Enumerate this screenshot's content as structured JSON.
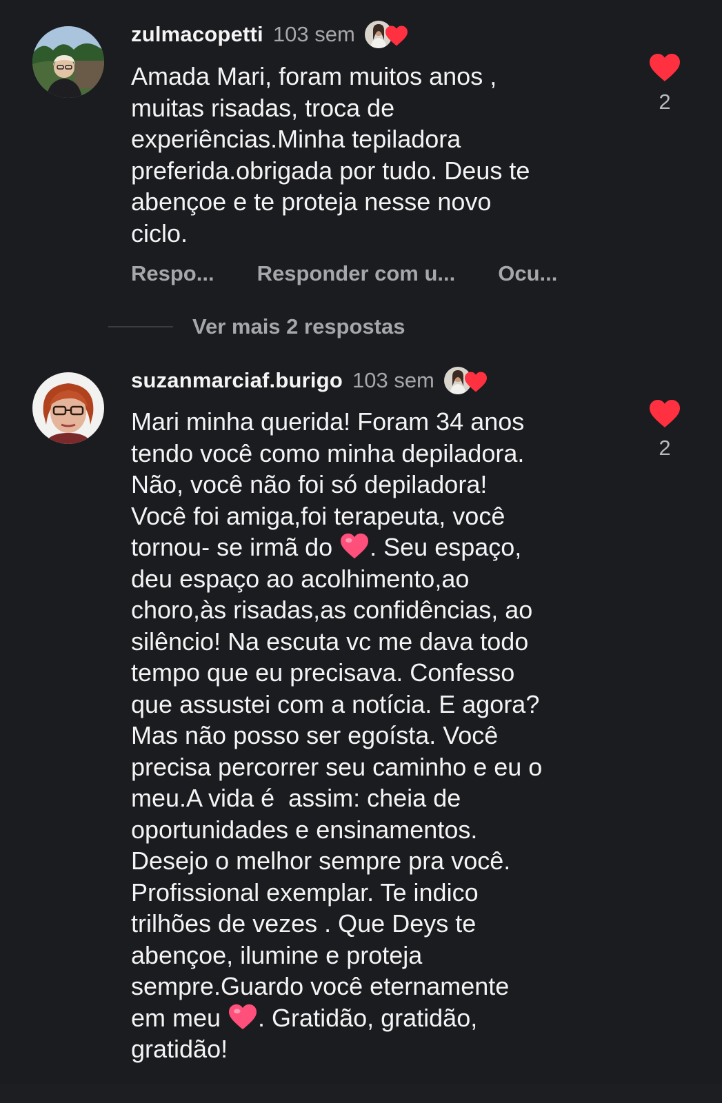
{
  "comments": [
    {
      "username": "zulmacopetti",
      "time": "103 sem",
      "text_lines": [
        "Amada Mari, foram muitos anos ,",
        "muitas risadas, troca de",
        "experiências.Minha tepiladora",
        "preferida.obrigada por tudo. Deus te",
        "abençoe e te proteja nesse novo",
        "ciclo."
      ],
      "like_count": "2",
      "actions": {
        "reply": "Respo...",
        "reply_with": "Responder com u...",
        "hide": "Ocu..."
      },
      "more_replies": "Ver mais 2 respostas"
    },
    {
      "username": "suzanmarciaf.burigo",
      "time": "103 sem",
      "text_parts": {
        "p1": "Mari minha querida! Foram 34 anos\ntendo você como minha depiladora.\nNão, você não foi só depiladora!\nVocê foi amiga,foi terapeuta, você\ntornou- se irmã do ",
        "p2": ". Seu espaço,\ndeu espaço ao acolhimento,ao\nchoro,às risadas,as confidências, ao\nsilêncio! Na escuta vc me dava todo\ntempo que eu precisava. Confesso\nque assustei com a notícia. E agora?\nMas não posso ser egoísta. Você\nprecisa percorrer seu caminho e eu o\nmeu.A vida é  assim: cheia de\noportunidades e ensinamentos.\nDesejo o melhor sempre pra você.\nProfissional exemplar. Te indico\ntrilhões de vezes . Que Deys te\nabençoe, ilumine e proteja\nsempre.Guardo você eternamente\nem meu ",
        "p3": ". Gratidão, gratidão,\ngratidão!"
      },
      "like_count": "2"
    }
  ],
  "colors": {
    "background": "#1b1c20",
    "like_red": "#ff3040",
    "emoji_heart": "#ff4f7b",
    "muted_text": "#a6a7ab"
  },
  "icons": [
    "heart-icon",
    "heart-emoji-icon",
    "avatar"
  ]
}
